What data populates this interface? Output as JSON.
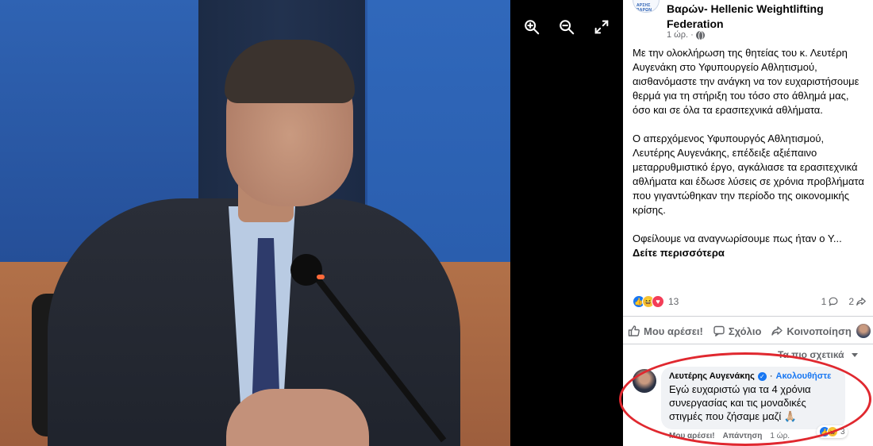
{
  "viewer": {
    "zoom_in_icon": "zoom-in-icon",
    "zoom_out_icon": "zoom-out-icon",
    "fullscreen_icon": "fullscreen-icon"
  },
  "post": {
    "page_name_line1": "Βαρών- Hellenic Weightlifting",
    "page_name_line2": "Federation",
    "logo_text": "ΑΡΣΗΣ ΒΑΡΩΝ",
    "timestamp": "1 ώρ.",
    "audience_icon": "globe-icon",
    "paragraph1": "Με την ολοκλήρωση της θητείας του κ. Λευτέρη Αυγενάκη στο Υφυπουργείο Αθλητισμού, αισθανόμαστε την ανάγκη να τον ευχαριστήσουμε θερμά για τη στήριξη του τόσο στο άθλημά μας, όσο και σε όλα τα ερασιτεχνικά αθλήματα.",
    "paragraph2": "Ο απερχόμενος Υφυπουργός Αθλητισμού, Λευτέρης Αυγενάκης, επέδειξε αξιέπαινο μεταρρυθμιστικό έργο, αγκάλιασε τα ερασιτεχνικά αθλήματα και έδωσε λύσεις σε χρόνια προβλήματα που γιγαντώθηκαν την περίοδο της οικονομικής κρίσης.",
    "paragraph3": "Οφείλουμε να αναγνωρίσουμε πως ήταν ο Υ...",
    "see_more": "Δείτε περισσότερα"
  },
  "reactions": {
    "count": "13",
    "comments_count": "1",
    "shares_count": "2"
  },
  "actions": {
    "like": "Μου αρέσει!",
    "comment": "Σχόλιο",
    "share": "Κοινοποίηση"
  },
  "sort": {
    "label": "Τα πιο σχετικά"
  },
  "comment": {
    "author": "Λευτέρης Αυγενάκης",
    "follow": "Ακολουθήστε",
    "text": "Εγώ ευχαριστώ για τα 4 χρόνια συνεργασίας και τις μοναδικές στιγμές που ζήσαμε μαζί 🙏🏼",
    "like": "Μου αρέσει!",
    "reply": "Απάντηση",
    "time": "1 ώρ.",
    "reaction_count": "3"
  },
  "colors": {
    "accent": "#1877f2",
    "annotation": "#e0282f"
  }
}
